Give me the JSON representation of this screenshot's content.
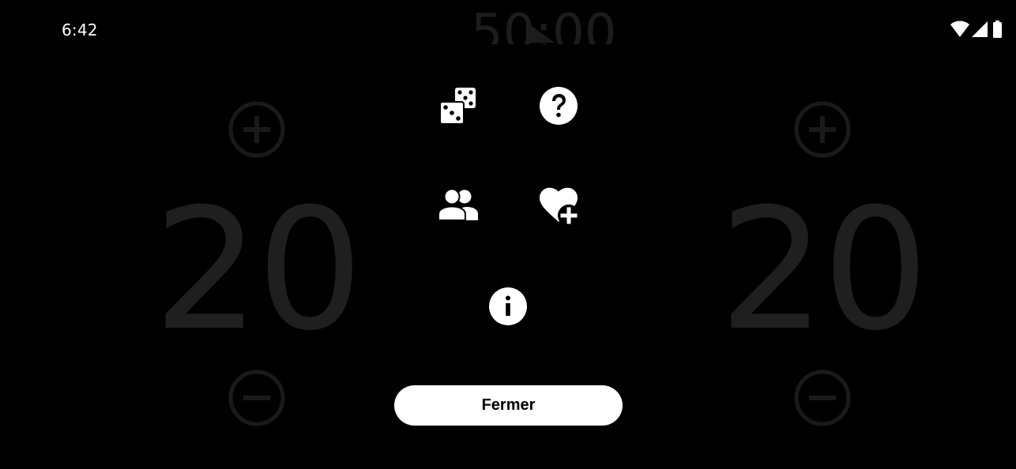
{
  "status_bar": {
    "time": "6:42",
    "icons": [
      "wifi-icon",
      "signal-icon",
      "battery-icon"
    ]
  },
  "background": {
    "timer": "50:00",
    "players": [
      {
        "life": "20",
        "icons": [
          "plus-circle-icon",
          "minus-circle-icon"
        ]
      },
      {
        "life": "20",
        "icons": [
          "plus-circle-icon",
          "minus-circle-icon"
        ]
      }
    ]
  },
  "menu": {
    "icons": [
      "dice-icon",
      "help-icon",
      "players-icon",
      "heart-add-icon",
      "info-icon"
    ],
    "close_label": "Fermer"
  },
  "colors": {
    "background": "#000000",
    "foreground": "#ffffff",
    "dimmed": "#1f1f1f",
    "button_text": "#000000"
  }
}
